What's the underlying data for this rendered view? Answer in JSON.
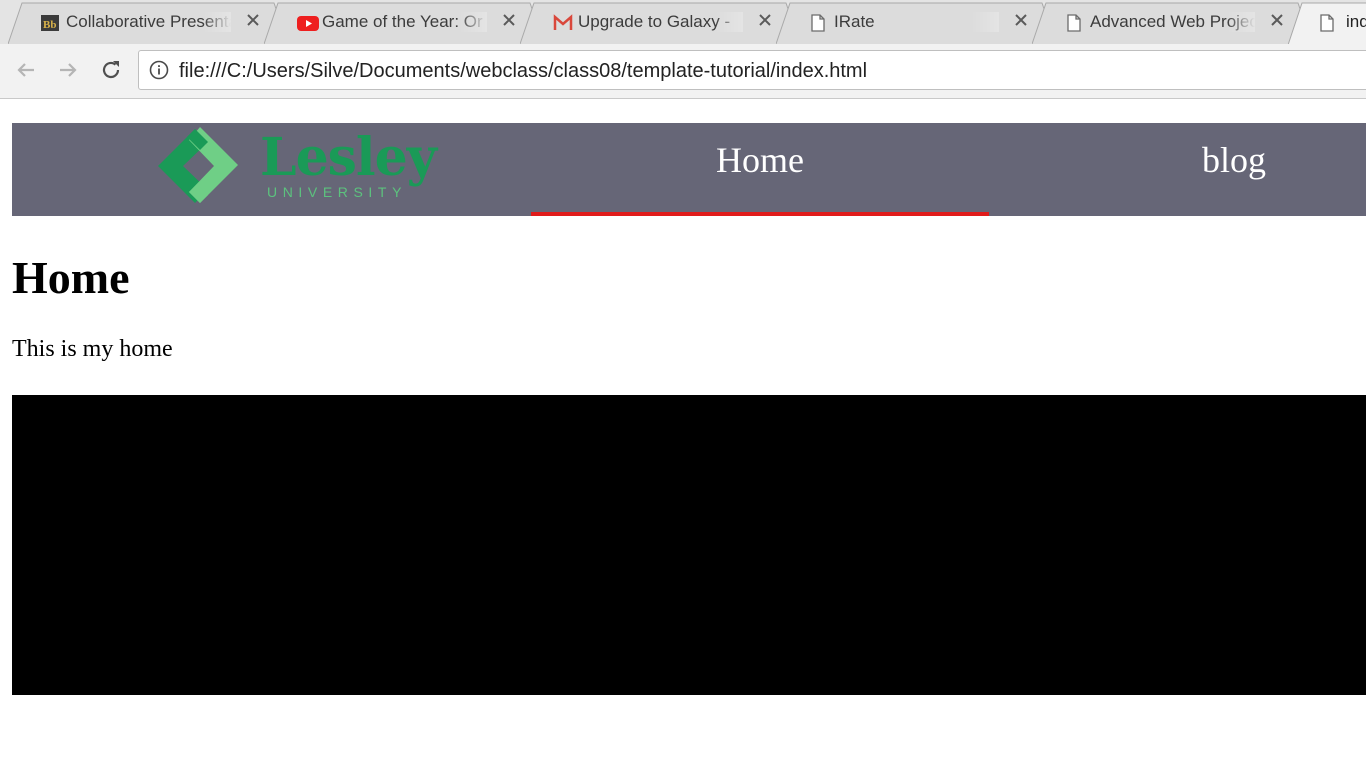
{
  "browser": {
    "tabs": [
      {
        "title": "Collaborative Presentation",
        "favicon": "blackboard-icon",
        "active": false
      },
      {
        "title": "Game of the Year: Or",
        "favicon": "youtube-icon",
        "active": false
      },
      {
        "title": "Upgrade to Galaxy -",
        "favicon": "gmail-icon",
        "active": false
      },
      {
        "title": "IRate",
        "favicon": "page-icon",
        "active": false
      },
      {
        "title": "Advanced Web Project",
        "favicon": "page-icon",
        "active": false
      },
      {
        "title": "index.html",
        "favicon": "page-icon",
        "active": true
      }
    ],
    "address": "file:///C:/Users/Silve/Documents/webclass/class08/template-tutorial/index.html"
  },
  "site": {
    "logo": {
      "wordmark": "Lesley",
      "subtitle": "UNIVERSITY"
    },
    "nav": [
      {
        "label": "Home",
        "active": true
      },
      {
        "label": "blog",
        "active": false
      }
    ],
    "colors": {
      "nav_bg": "#666677",
      "active_underline": "#e01b1b",
      "logo_green": "#1a9a57"
    }
  },
  "content": {
    "heading": "Home",
    "text": "This is my home"
  }
}
